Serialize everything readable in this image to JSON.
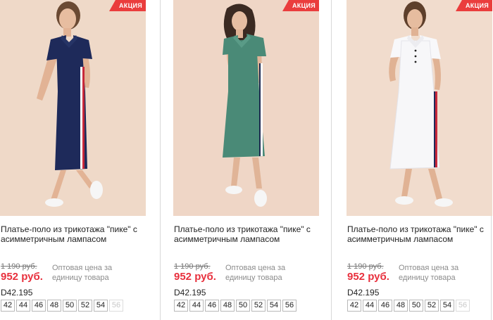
{
  "colors": {
    "accent": "#ea3d3d",
    "price": "#e8303d",
    "photo_background": "#f1dccd"
  },
  "products": [
    {
      "badge": "АКЦИЯ",
      "dress_color": "navy",
      "title": "Платье-поло из трикотажа \"пике\" с асимметричным лампасом",
      "old_price": "1 190 руб.",
      "price": "952 руб.",
      "wholesale": "Оптовая цена за единицу товара",
      "sku": "D42.195",
      "sizes": [
        {
          "label": "42",
          "available": true
        },
        {
          "label": "44",
          "available": true
        },
        {
          "label": "46",
          "available": true
        },
        {
          "label": "48",
          "available": true
        },
        {
          "label": "50",
          "available": true
        },
        {
          "label": "52",
          "available": true
        },
        {
          "label": "54",
          "available": true
        },
        {
          "label": "56",
          "available": false
        }
      ]
    },
    {
      "badge": "АКЦИЯ",
      "dress_color": "green",
      "title": "Платье-поло из трикотажа \"пике\" с асимметричным лампасом",
      "old_price": "1 190 руб.",
      "price": "952 руб.",
      "wholesale": "Оптовая цена за единицу товара",
      "sku": "D42.195",
      "sizes": [
        {
          "label": "42",
          "available": true
        },
        {
          "label": "44",
          "available": true
        },
        {
          "label": "46",
          "available": true
        },
        {
          "label": "48",
          "available": true
        },
        {
          "label": "50",
          "available": true
        },
        {
          "label": "52",
          "available": true
        },
        {
          "label": "54",
          "available": true
        },
        {
          "label": "56",
          "available": true
        }
      ]
    },
    {
      "badge": "АКЦИЯ",
      "dress_color": "white",
      "title": "Платье-поло из трикотажа \"пике\" с асимметричным лампасом",
      "old_price": "1 190 руб.",
      "price": "952 руб.",
      "wholesale": "Оптовая цена за единицу товара",
      "sku": "D42.195",
      "sizes": [
        {
          "label": "42",
          "available": true
        },
        {
          "label": "44",
          "available": true
        },
        {
          "label": "46",
          "available": true
        },
        {
          "label": "48",
          "available": true
        },
        {
          "label": "50",
          "available": true
        },
        {
          "label": "52",
          "available": true
        },
        {
          "label": "54",
          "available": true
        },
        {
          "label": "56",
          "available": false
        }
      ]
    }
  ]
}
